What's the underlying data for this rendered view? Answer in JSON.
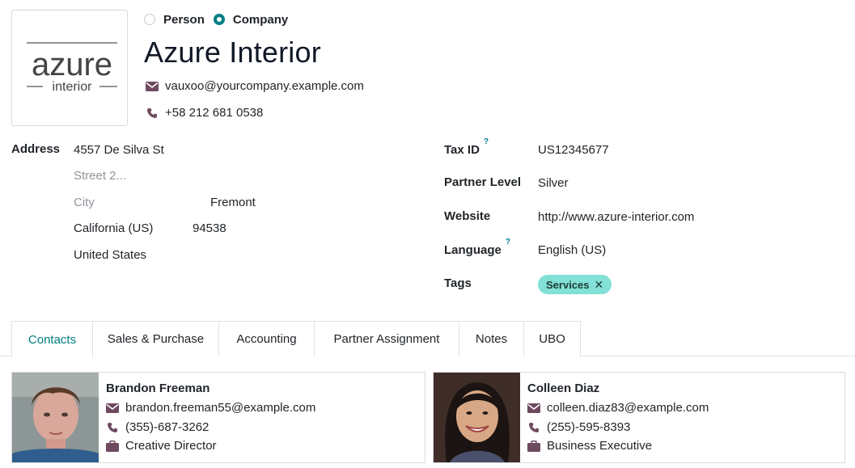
{
  "company_type": {
    "options": [
      {
        "label": "Person",
        "checked": false
      },
      {
        "label": "Company",
        "checked": true
      }
    ]
  },
  "partner": {
    "name": "Azure Interior",
    "email": "vauxoo@yourcompany.example.com",
    "phone": "+58 212 681 0538",
    "logo": {
      "text_main": "azure",
      "text_sub": "interior"
    }
  },
  "address": {
    "label": "Address",
    "street": "4557 De Silva St",
    "street2_placeholder": "Street 2...",
    "city_placeholder": "City",
    "city_value": "Fremont",
    "state": "California (US)",
    "zip": "94538",
    "country": "United States"
  },
  "fields": {
    "tax_id": {
      "label": "Tax ID",
      "help": "?",
      "value": "US12345677"
    },
    "partner_level": {
      "label": "Partner Level",
      "value": "Silver"
    },
    "website": {
      "label": "Website",
      "value": "http://www.azure-interior.com"
    },
    "language": {
      "label": "Language",
      "help": "?",
      "value": "English (US)"
    },
    "tags": {
      "label": "Tags",
      "items": [
        "Services"
      ],
      "remove_glyph": "✕"
    }
  },
  "tabs": [
    "Contacts",
    "Sales & Purchase",
    "Accounting",
    "Partner Assignment",
    "Notes",
    "UBO"
  ],
  "active_tab": "Contacts",
  "contacts": [
    {
      "name": "Brandon Freeman",
      "email": "brandon.freeman55@example.com",
      "phone": "(355)-687-3262",
      "function": "Creative Director"
    },
    {
      "name": "Colleen Diaz",
      "email": "colleen.diaz83@example.com",
      "phone": "(255)-595-8393",
      "function": "Business Executive"
    }
  ],
  "colors": {
    "accent": "#017e84",
    "icon": "#6e4a5f",
    "tag_bg": "#82e0d6",
    "placeholder": "#8f959c"
  }
}
